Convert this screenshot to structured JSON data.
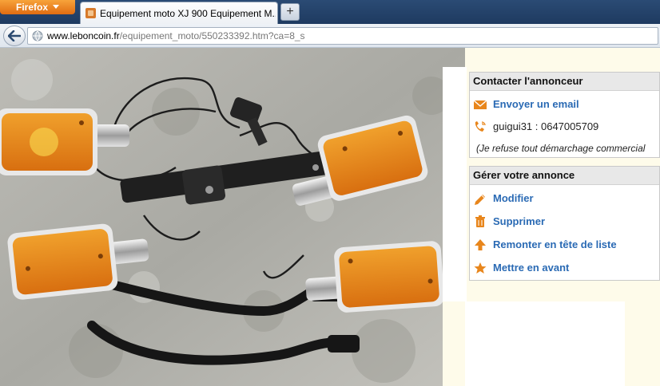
{
  "browser": {
    "menu_button_label": "Firefox",
    "tab_title": "Equipement moto XJ 900 Equipement M...",
    "new_tab_label": "+",
    "url_domain": "www.leboncoin.fr",
    "url_path": "/equipement_moto/550233392.htm?ca=8_s"
  },
  "listing": {
    "photo_alt": "Clignotants, faisceau et supports moto"
  },
  "contact": {
    "title": "Contacter l'annonceur",
    "email_label": "Envoyer un email",
    "phone_text": "guigui31 : 0647005709",
    "note": "(Je refuse tout démarchage commercial"
  },
  "manage": {
    "title": "Gérer votre annonce",
    "items": [
      {
        "label": "Modifier",
        "icon": "pencil-icon"
      },
      {
        "label": "Supprimer",
        "icon": "trash-icon"
      },
      {
        "label": "Remonter en tête de liste",
        "icon": "arrow-up-icon"
      },
      {
        "label": "Mettre en avant",
        "icon": "star-icon"
      }
    ]
  },
  "colors": {
    "link": "#2a6ab4",
    "icon_orange": "#e8861c",
    "panel_header": "#e8e8e8",
    "sidebar_bg": "#fefbea"
  }
}
